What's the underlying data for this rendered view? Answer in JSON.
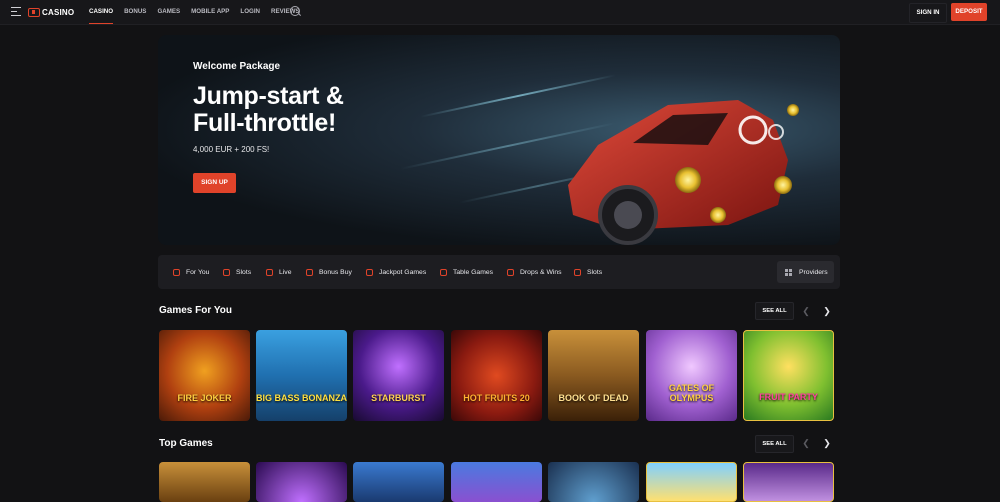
{
  "header": {
    "logo_text": "CASINO",
    "nav": [
      "CASINO",
      "BONUS",
      "GAMES",
      "MOBILE APP",
      "LOGIN",
      "REVIEWS"
    ],
    "signin_label": "SIGN IN",
    "deposit_label": "DEPOSIT",
    "accent_color": "#e0432a"
  },
  "hero": {
    "subtitle": "Welcome Package",
    "title_line1": "Jump-start &",
    "title_line2": "Full-throttle!",
    "offer": "4,000 EUR + 200 FS!",
    "cta_label": "SIGN UP"
  },
  "categories": {
    "items": [
      "For You",
      "Slots",
      "Live",
      "Bonus Buy",
      "Jackpot Games",
      "Table Games",
      "Drops & Wins",
      "Slots"
    ],
    "providers_label": "Providers"
  },
  "games_for_you": {
    "title": "Games For You",
    "see_all": "SEE ALL",
    "tiles": [
      "FIRE JOKER",
      "BIG BASS BONANZA",
      "STARBURST",
      "HOT FRUITS 20",
      "BOOK OF DEAD",
      "GATES OF OLYMPUS",
      "FRUIT PARTY"
    ]
  },
  "top_games": {
    "title": "Top Games",
    "see_all": "SEE ALL"
  }
}
